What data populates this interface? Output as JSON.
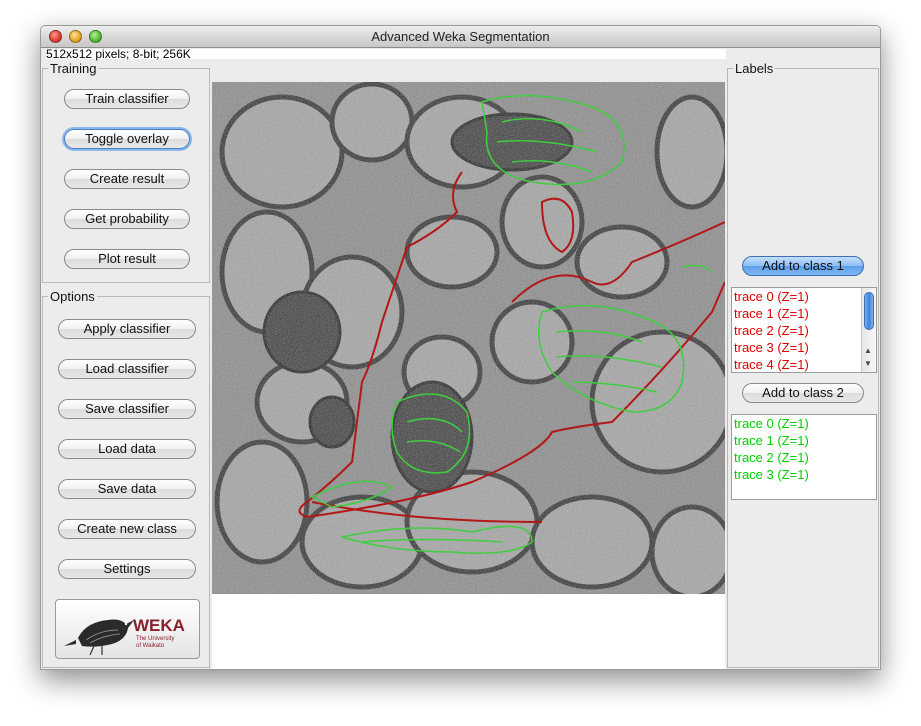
{
  "window": {
    "title": "Advanced Weka Segmentation"
  },
  "image_info": "512x512 pixels; 8-bit; 256K",
  "training": {
    "legend": "Training",
    "buttons": [
      "Train classifier",
      "Toggle overlay",
      "Create result",
      "Get probability",
      "Plot result"
    ]
  },
  "options": {
    "legend": "Options",
    "buttons": [
      "Apply classifier",
      "Load classifier",
      "Save classifier",
      "Load data",
      "Save data",
      "Create new class",
      "Settings"
    ]
  },
  "logo": {
    "name": "WEKA",
    "sub1": "The University",
    "sub2": "of Waikato"
  },
  "labels": {
    "legend": "Labels",
    "class1_button": "Add to class 1",
    "class2_button": "Add to class 2",
    "class1_traces": [
      "trace 0 (Z=1)",
      "trace 1 (Z=1)",
      "trace 2 (Z=1)",
      "trace 3 (Z=1)",
      "trace 4 (Z=1)"
    ],
    "class2_traces": [
      "trace 0 (Z=1)",
      "trace 1 (Z=1)",
      "trace 2 (Z=1)",
      "trace 3 (Z=1)"
    ]
  },
  "colors": {
    "class1": "#e00000",
    "class2": "#00d000",
    "trace_red": "#b31818",
    "trace_green": "#3ecf3e"
  },
  "icons": [
    "close-icon",
    "minimize-icon",
    "maximize-icon",
    "weka-bird-icon",
    "scroll-up-icon",
    "scroll-down-icon"
  ]
}
